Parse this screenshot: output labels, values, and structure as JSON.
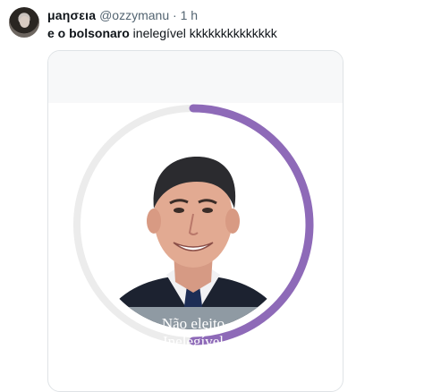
{
  "tweet": {
    "display_name": "μaησειa",
    "handle": "@ozzymanu",
    "separator": "·",
    "time": "1 h",
    "text_bold": "e o bolsonaro",
    "text_rest": " inelegível kkkkkkkkkkkkkk"
  },
  "card": {
    "caption_line1": "Não eleito",
    "caption_line2": "Inelegível"
  },
  "colors": {
    "ring_progress": "#8e6ab8",
    "ring_track": "#ececec",
    "caption_band": "#8f9aa3"
  },
  "ring": {
    "progress_fraction": 0.5
  }
}
